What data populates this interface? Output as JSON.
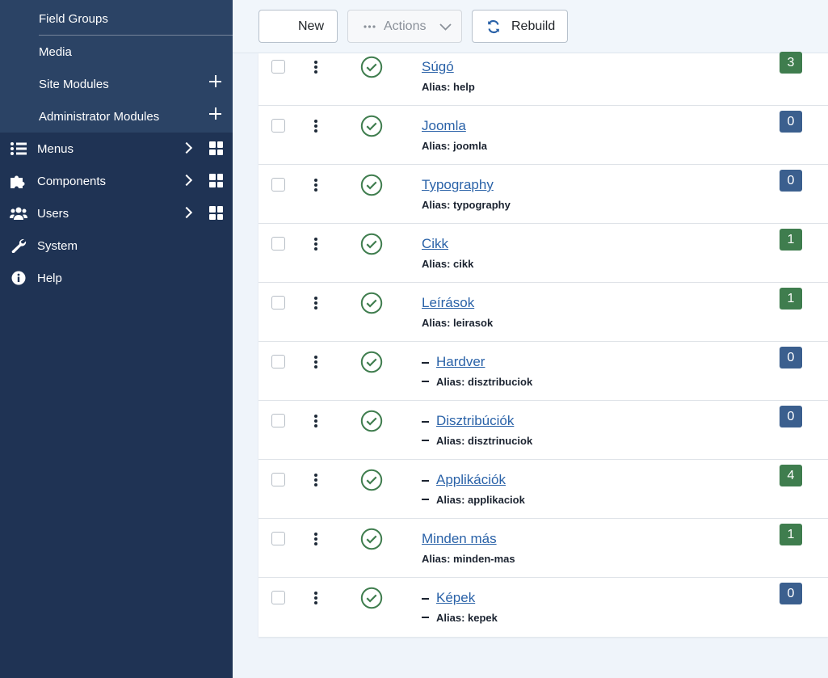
{
  "sidebar": {
    "sub_items": [
      {
        "label": "Field Groups",
        "has_add": false
      },
      {
        "label": "Media",
        "has_add": false
      },
      {
        "label": "Site Modules",
        "has_add": true
      },
      {
        "label": "Administrator Modules",
        "has_add": true
      }
    ],
    "main_items": [
      {
        "label": "Menus",
        "icon": "list-icon",
        "expandable": true
      },
      {
        "label": "Components",
        "icon": "puzzle-icon",
        "expandable": true
      },
      {
        "label": "Users",
        "icon": "users-icon",
        "expandable": true
      },
      {
        "label": "System",
        "icon": "wrench-icon",
        "expandable": false
      },
      {
        "label": "Help",
        "icon": "info-icon",
        "expandable": false
      }
    ]
  },
  "toolbar": {
    "new_label": "New",
    "actions_label": "Actions",
    "rebuild_label": "Rebuild"
  },
  "colors": {
    "sidebar_bg": "#1f3354",
    "sidebar_sub_bg": "#2b4365",
    "link": "#2a62a8",
    "badge_green": "#3f7d4e",
    "badge_blue": "#3b5f8e",
    "published_green": "#3f7d4e"
  },
  "rows": [
    {
      "title": "Súgó",
      "alias_label": "Alias:",
      "alias": "help",
      "nested": false,
      "count": "3",
      "badge": "green"
    },
    {
      "title": "Joomla",
      "alias_label": "Alias:",
      "alias": "joomla",
      "nested": false,
      "count": "0",
      "badge": "blue"
    },
    {
      "title": "Typography",
      "alias_label": "Alias:",
      "alias": "typography",
      "nested": false,
      "count": "0",
      "badge": "blue"
    },
    {
      "title": "Cikk",
      "alias_label": "Alias:",
      "alias": "cikk",
      "nested": false,
      "count": "1",
      "badge": "green"
    },
    {
      "title": "Leírások",
      "alias_label": "Alias:",
      "alias": "leirasok",
      "nested": false,
      "count": "1",
      "badge": "green"
    },
    {
      "title": "Hardver",
      "alias_label": "Alias:",
      "alias": "disztribuciok",
      "nested": true,
      "count": "0",
      "badge": "blue"
    },
    {
      "title": "Disztribúciók",
      "alias_label": "Alias:",
      "alias": "disztrinuciok",
      "nested": true,
      "count": "0",
      "badge": "blue"
    },
    {
      "title": "Applikációk",
      "alias_label": "Alias:",
      "alias": "applikaciok",
      "nested": true,
      "count": "4",
      "badge": "green"
    },
    {
      "title": "Minden más",
      "alias_label": "Alias:",
      "alias": "minden-mas",
      "nested": false,
      "count": "1",
      "badge": "green"
    },
    {
      "title": "Képek",
      "alias_label": "Alias:",
      "alias": "kepek",
      "nested": true,
      "count": "0",
      "badge": "blue"
    }
  ]
}
